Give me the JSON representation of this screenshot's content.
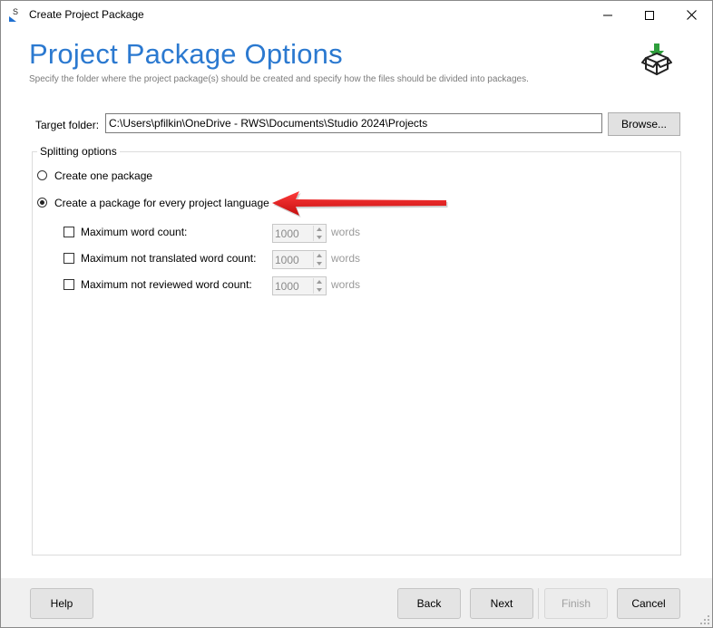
{
  "window": {
    "title": "Create Project Package",
    "icons": {
      "app": "trados-s-icon",
      "minimize": "minimize-icon",
      "maximize": "maximize-icon",
      "close": "close-icon"
    }
  },
  "header": {
    "title": "Project Package Options",
    "subtitle": "Specify the folder where the project package(s) should be created and specify how the files should be divided into packages.",
    "icon": "package-download-icon"
  },
  "target": {
    "label": "Target folder:",
    "value": "C:\\Users\\pfilkin\\OneDrive - RWS\\Documents\\Studio 2024\\Projects",
    "browse_label": "Browse..."
  },
  "splitting": {
    "legend": "Splitting options",
    "options": [
      {
        "label": "Create one package",
        "selected": false
      },
      {
        "label": "Create a package for every project language",
        "selected": true
      }
    ],
    "limits": [
      {
        "label": "Maximum word count:",
        "checked": false,
        "value": "1000",
        "unit": "words"
      },
      {
        "label": "Maximum not translated word count:",
        "checked": false,
        "value": "1000",
        "unit": "words"
      },
      {
        "label": "Maximum not reviewed word count:",
        "checked": false,
        "value": "1000",
        "unit": "words"
      }
    ]
  },
  "annotation": {
    "color": "#e02020",
    "icon": "red-arrow-annotation"
  },
  "footer": {
    "help": "Help",
    "back": "Back",
    "next": "Next",
    "finish": "Finish",
    "cancel": "Cancel"
  }
}
